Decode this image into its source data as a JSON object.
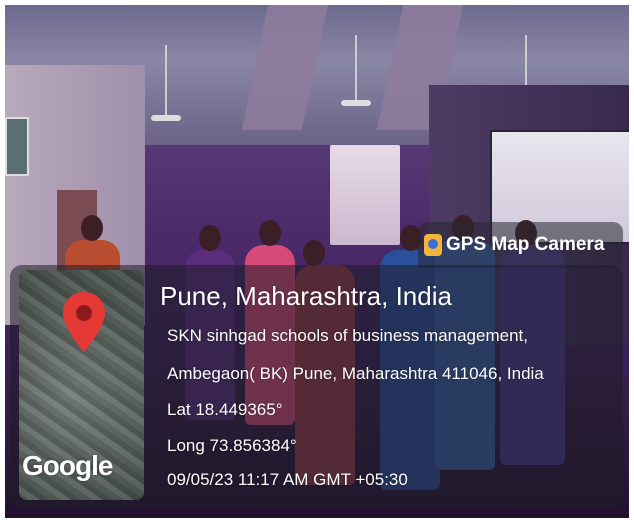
{
  "watermark": {
    "label": "GPS Map Camera",
    "icon": "gps-map-camera-icon"
  },
  "map": {
    "provider": "Google",
    "pin_icon": "location-pin-icon",
    "pin_color": "#e53935"
  },
  "location": {
    "title": "Pune, Maharashtra, India",
    "address_line1": "SKN sinhgad schools of business management,",
    "address_line2": "Ambegaon( BK) Pune, Maharashtra 411046, India",
    "latitude": "Lat 18.449365°",
    "longitude": "Long 73.856384°",
    "timestamp": "09/05/23 11:17 AM GMT +05:30"
  }
}
